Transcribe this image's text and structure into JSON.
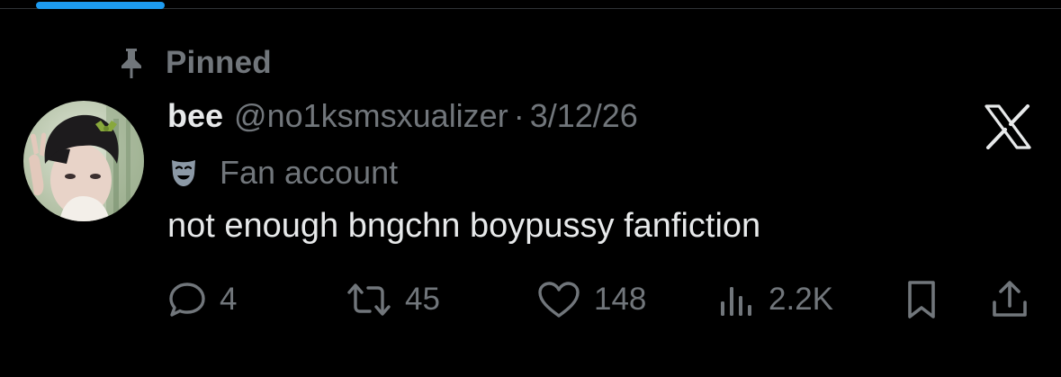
{
  "pinned": {
    "label": "Pinned",
    "icon": "pin-icon"
  },
  "tweet": {
    "author": {
      "display_name": "bee",
      "handle": "@no1ksmsxualizer",
      "avatar": "avatar"
    },
    "separator": "·",
    "date": "3/12/26",
    "label": {
      "icon": "theater-mask-icon",
      "text": "Fan account"
    },
    "text": "not enough bngchn boypussy fanfiction",
    "actions": {
      "replies": "4",
      "reposts": "45",
      "likes": "148",
      "views": "2.2K"
    }
  },
  "icons": {
    "platform_logo": "x-logo-icon",
    "reply": "reply-icon",
    "repost": "repost-icon",
    "like": "heart-icon",
    "views": "views-icon",
    "bookmark": "bookmark-icon",
    "share": "share-icon"
  },
  "colors": {
    "background": "#000000",
    "primary_text": "#e7e9ea",
    "secondary_text": "#71767b",
    "accent": "#1d9bf0",
    "divider": "#2f3336"
  }
}
